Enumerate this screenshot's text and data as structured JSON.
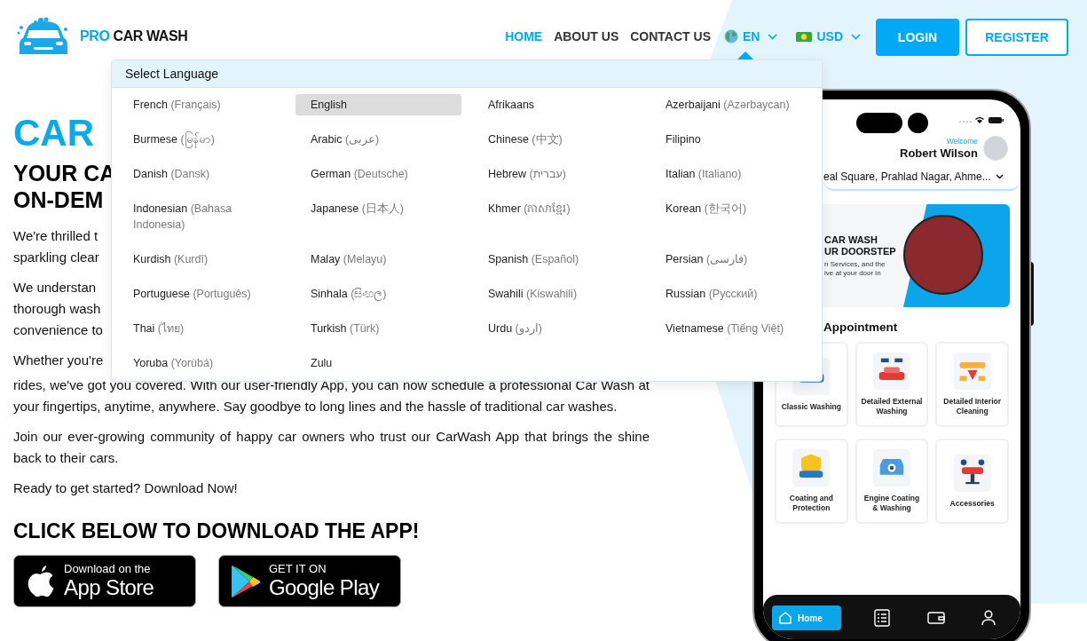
{
  "header": {
    "logo": {
      "accent": "PRO",
      "text": "CAR WASH"
    },
    "nav": [
      {
        "label": "HOME",
        "selected": true
      },
      {
        "label": "ABOUT US",
        "selected": false
      },
      {
        "label": "CONTACT US",
        "selected": false
      }
    ],
    "language": {
      "code": "EN",
      "expanded": true
    },
    "currency": {
      "code": "USD"
    },
    "buttons": [
      {
        "label": "LOGIN",
        "kind": "primary"
      },
      {
        "label": "REGISTER",
        "kind": "outline"
      }
    ]
  },
  "language_menu": {
    "title": "Select Language",
    "languages": [
      {
        "name": "French",
        "native": "(Français)",
        "selected": false
      },
      {
        "name": "English",
        "selected": true
      },
      {
        "name": "Afrikaans",
        "selected": false
      },
      {
        "name": "Azerbaijani",
        "native": "(Azərbaycan)",
        "selected": false
      },
      {
        "name": "Burmese",
        "native": "(မြန်မာ)",
        "selected": false
      },
      {
        "name": "Arabic",
        "native": "(عربى)",
        "selected": false
      },
      {
        "name": "Chinese",
        "native": "(中文)",
        "selected": false
      },
      {
        "name": "Filipino",
        "selected": false
      },
      {
        "name": "Danish",
        "native": "(Dansk)",
        "selected": false
      },
      {
        "name": "German",
        "native": "(Deutsche)",
        "selected": false
      },
      {
        "name": "Hebrew",
        "native": "(עברית)",
        "selected": false
      },
      {
        "name": "Italian",
        "native": "(Italiano)",
        "selected": false
      },
      {
        "name": "Indonesian",
        "native": "(Bahasa Indonesia)",
        "selected": false
      },
      {
        "name": "Japanese",
        "native": "(日本人)",
        "selected": false
      },
      {
        "name": "Khmer",
        "native": "(ភាសាខ្មែរ)",
        "selected": false
      },
      {
        "name": "Korean",
        "native": "(한국어)",
        "selected": false
      },
      {
        "name": "Kurdish",
        "native": "(Kurdî)",
        "selected": false
      },
      {
        "name": "Malay",
        "native": "(Melayu)",
        "selected": false
      },
      {
        "name": "Spanish",
        "native": "(Español)",
        "selected": false
      },
      {
        "name": "Persian",
        "native": "(فارسی)",
        "selected": false
      },
      {
        "name": "Portuguese",
        "native": "(Português)",
        "selected": false
      },
      {
        "name": "Sinhala",
        "native": "(සිංහල)",
        "selected": false
      },
      {
        "name": "Swahili",
        "native": "(Kiswahili)",
        "selected": false
      },
      {
        "name": "Russian",
        "native": "(Русский)",
        "selected": false
      },
      {
        "name": "Thai",
        "native": "(ไทย)",
        "selected": false
      },
      {
        "name": "Turkish",
        "native": "(Türk)",
        "selected": false
      },
      {
        "name": "Urdu",
        "native": "(اردو)",
        "selected": false
      },
      {
        "name": "Vietnamese",
        "native": "(Tiếng Việt)",
        "selected": false
      },
      {
        "name": "Yoruba",
        "native": "(Yorùbá)",
        "selected": false
      },
      {
        "name": "Zulu",
        "selected": false
      }
    ]
  },
  "hero": {
    "title": "CAR",
    "subtitle_lines": [
      "YOUR CA",
      "ON-DEM"
    ],
    "paragraph_fragments": [
      [
        "We're thrilled t",
        "sparkling clear"
      ],
      [
        "We understan",
        "thorough wash",
        "convenience to"
      ],
      [
        "Whether you're"
      ]
    ],
    "paragraphs": [
      "rides, we've got you covered. With our user-friendly App, you can now schedule a professional Car Wash at your fingertips, anytime, anywhere. Say goodbye to long lines and the hassle of traditional car washes.",
      "Join our ever-growing community of happy car owners who trust our CarWash App that brings the shine back to their cars.",
      "Ready to get started? Download Now!"
    ]
  },
  "download": {
    "heading": "CLICK BELOW TO DOWNLOAD THE APP!",
    "badges": [
      {
        "kind": "apple",
        "small": "Download on the",
        "large": "App Store"
      },
      {
        "kind": "google",
        "small": "GET IT ON",
        "large": "Google Play"
      }
    ]
  },
  "phone": {
    "welcome": "Welcome",
    "user_name": "Robert Wilson",
    "address": "eal Square, Prahlad Nagar, Ahme...",
    "banner": {
      "lines": [
        "CAR WASH",
        "UR DOORSTEP"
      ],
      "small_lines": [
        "n Services, and the",
        "ive at your door in"
      ]
    },
    "section_title": "Appointment",
    "services": [
      {
        "label": "Classic Washing",
        "kind": "classic"
      },
      {
        "label": "Detailed External Washing",
        "kind": "external"
      },
      {
        "label": "Detailed Interior Cleaning",
        "kind": "interior"
      },
      {
        "label": "Coating and Protection",
        "kind": "coating"
      },
      {
        "label": "Engine Coating & Washing",
        "kind": "engine"
      },
      {
        "label": "Accessories",
        "kind": "accessories"
      }
    ],
    "bottom_nav": [
      {
        "kind": "home",
        "label": "Home",
        "selected": true
      },
      {
        "kind": "bookings",
        "selected": false
      },
      {
        "kind": "wallet",
        "selected": false
      },
      {
        "kind": "profile",
        "selected": false
      }
    ]
  }
}
